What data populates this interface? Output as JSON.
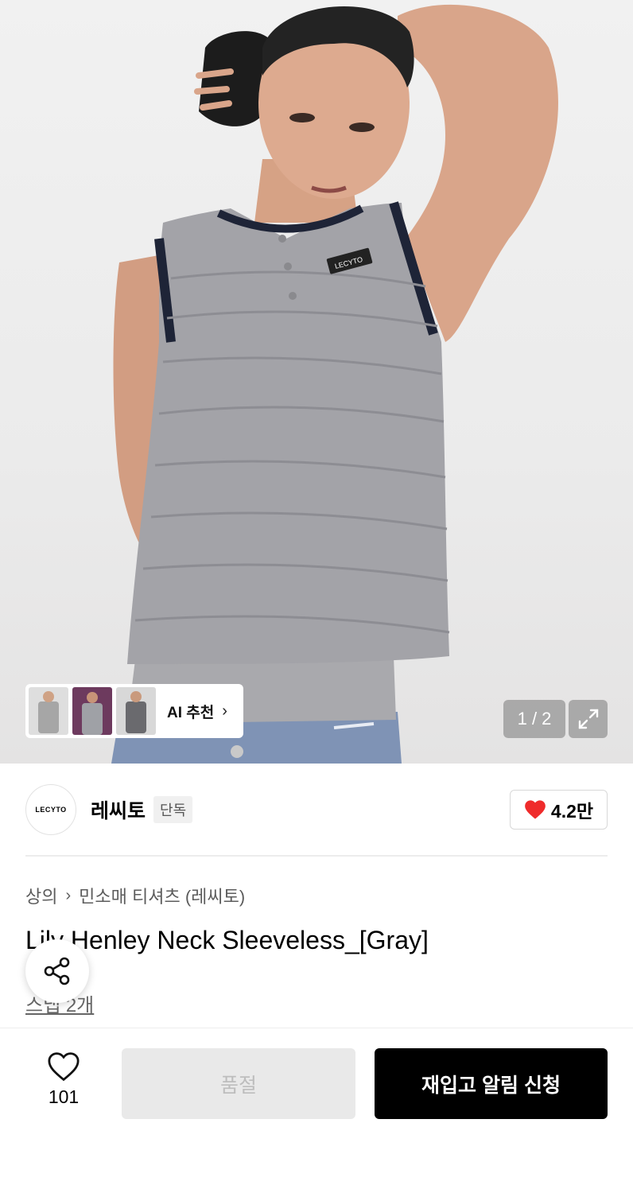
{
  "hero": {
    "counter": "1 / 2",
    "tank_label": "LECYTO",
    "ai_label": "AI 추천",
    "ai_chevron": "›"
  },
  "brand": {
    "logo_text": "LECYTO",
    "name": "레씨토",
    "tag": "단독",
    "likes": "4.2만"
  },
  "breadcrumb": {
    "category": "상의",
    "separator": "›",
    "subcategory": "민소매 티셔츠 (레씨토)"
  },
  "product": {
    "title": "Lily Henley Neck Sleeveless_[Gray]",
    "snap": "스냅 2개"
  },
  "bottom_bar": {
    "wish_count": "101",
    "soldout_label": "품절",
    "restock_label": "재입고 알림 신청"
  },
  "colors": {
    "heart_red": "#ef2b2b",
    "primary_black": "#000000",
    "disabled_bg": "#e9e9e9",
    "disabled_text": "#bdbdbd"
  },
  "icons": [
    "heart-icon",
    "share-icon",
    "expand-icon",
    "chevron-right-icon"
  ]
}
